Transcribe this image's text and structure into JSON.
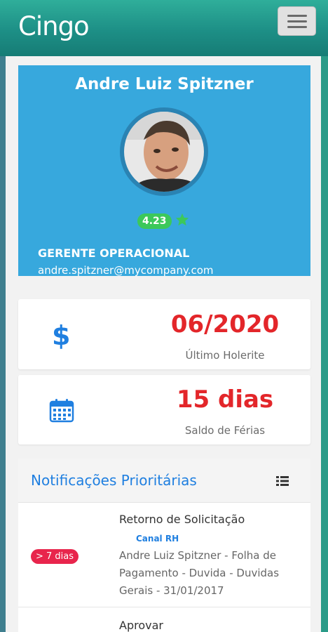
{
  "app": {
    "brand": "Cingo"
  },
  "profile": {
    "name": "Andre Luiz Spitzner",
    "rating": "4.23",
    "job_title": "GERENTE OPERACIONAL",
    "email": "andre.spitzner@mycompany.com"
  },
  "cards": {
    "payslip": {
      "value": "06/2020",
      "label": "Último Holerite"
    },
    "vacation": {
      "value": "15 dias",
      "label": "Saldo de Férias"
    }
  },
  "notifications": {
    "title": "Notificações Prioritárias",
    "items": [
      {
        "age": "> 7 dias",
        "subject": "Retorno de Solicitação",
        "channel": "Canal RH",
        "description": "Andre Luiz Spitzner - Folha de Pagamento - Duvida - Duvidas Gerais - 31/01/2017"
      },
      {
        "subject": "Aprovar"
      }
    ]
  },
  "colors": {
    "header": "#1d8f86",
    "profile_bg": "#37a8dd",
    "accent_red": "#e3262a",
    "accent_blue": "#1f7fe0",
    "badge_green": "#3cc85a",
    "badge_red": "#e8254c"
  },
  "icons": {
    "menu": "hamburger-icon",
    "star": "star-icon",
    "payslip": "dollar-icon",
    "vacation": "calendar-icon",
    "list": "list-icon"
  }
}
